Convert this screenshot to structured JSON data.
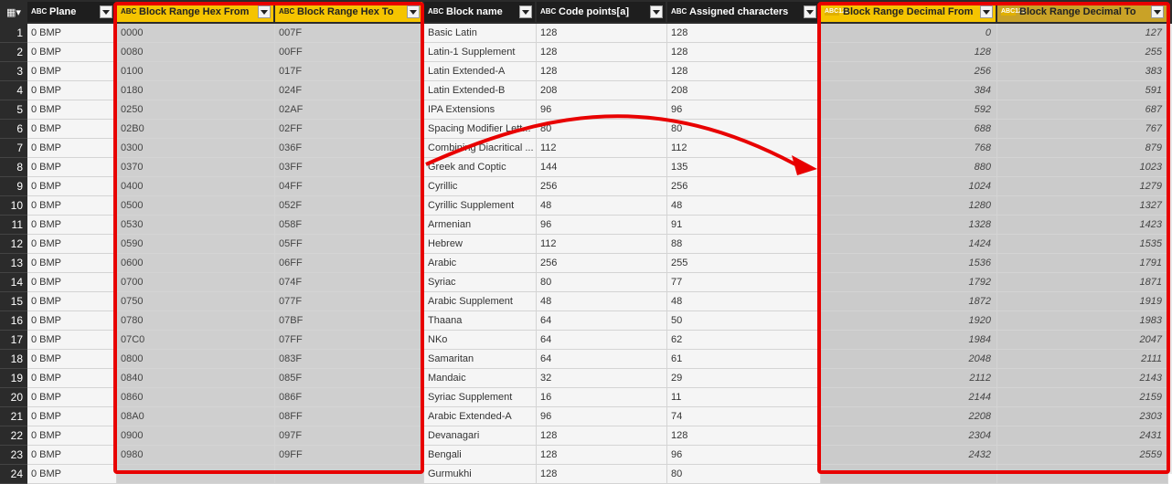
{
  "columns": [
    {
      "label": "Plane",
      "type_icon": "text-type-icon"
    },
    {
      "label": "Block Range Hex From",
      "type_icon": "text-type-icon"
    },
    {
      "label": "Block Range Hex To",
      "type_icon": "text-type-icon"
    },
    {
      "label": "Block name",
      "type_icon": "text-type-icon"
    },
    {
      "label": "Code points[a]",
      "type_icon": "text-type-icon"
    },
    {
      "label": "Assigned characters",
      "type_icon": "text-type-icon"
    },
    {
      "label": "Block Range Decimal From",
      "type_icon": "any-type-icon"
    },
    {
      "label": "Block Range Decimal To",
      "type_icon": "any-type-icon"
    }
  ],
  "type_icon_text": "ABC",
  "type_icon_any": "ABC123",
  "rows": [
    [
      "1",
      "0 BMP",
      "0000",
      "007F",
      "Basic Latin",
      "128",
      "128",
      "0",
      "127"
    ],
    [
      "2",
      "0 BMP",
      "0080",
      "00FF",
      "Latin-1 Supplement",
      "128",
      "128",
      "128",
      "255"
    ],
    [
      "3",
      "0 BMP",
      "0100",
      "017F",
      "Latin Extended-A",
      "128",
      "128",
      "256",
      "383"
    ],
    [
      "4",
      "0 BMP",
      "0180",
      "024F",
      "Latin Extended-B",
      "208",
      "208",
      "384",
      "591"
    ],
    [
      "5",
      "0 BMP",
      "0250",
      "02AF",
      "IPA Extensions",
      "96",
      "96",
      "592",
      "687"
    ],
    [
      "6",
      "0 BMP",
      "02B0",
      "02FF",
      "Spacing Modifier Lett...",
      "80",
      "80",
      "688",
      "767"
    ],
    [
      "7",
      "0 BMP",
      "0300",
      "036F",
      "Combining Diacritical ...",
      "112",
      "112",
      "768",
      "879"
    ],
    [
      "8",
      "0 BMP",
      "0370",
      "03FF",
      "Greek and Coptic",
      "144",
      "135",
      "880",
      "1023"
    ],
    [
      "9",
      "0 BMP",
      "0400",
      "04FF",
      "Cyrillic",
      "256",
      "256",
      "1024",
      "1279"
    ],
    [
      "10",
      "0 BMP",
      "0500",
      "052F",
      "Cyrillic Supplement",
      "48",
      "48",
      "1280",
      "1327"
    ],
    [
      "11",
      "0 BMP",
      "0530",
      "058F",
      "Armenian",
      "96",
      "91",
      "1328",
      "1423"
    ],
    [
      "12",
      "0 BMP",
      "0590",
      "05FF",
      "Hebrew",
      "112",
      "88",
      "1424",
      "1535"
    ],
    [
      "13",
      "0 BMP",
      "0600",
      "06FF",
      "Arabic",
      "256",
      "255",
      "1536",
      "1791"
    ],
    [
      "14",
      "0 BMP",
      "0700",
      "074F",
      "Syriac",
      "80",
      "77",
      "1792",
      "1871"
    ],
    [
      "15",
      "0 BMP",
      "0750",
      "077F",
      "Arabic Supplement",
      "48",
      "48",
      "1872",
      "1919"
    ],
    [
      "16",
      "0 BMP",
      "0780",
      "07BF",
      "Thaana",
      "64",
      "50",
      "1920",
      "1983"
    ],
    [
      "17",
      "0 BMP",
      "07C0",
      "07FF",
      "NKo",
      "64",
      "62",
      "1984",
      "2047"
    ],
    [
      "18",
      "0 BMP",
      "0800",
      "083F",
      "Samaritan",
      "64",
      "61",
      "2048",
      "2111"
    ],
    [
      "19",
      "0 BMP",
      "0840",
      "085F",
      "Mandaic",
      "32",
      "29",
      "2112",
      "2143"
    ],
    [
      "20",
      "0 BMP",
      "0860",
      "086F",
      "Syriac Supplement",
      "16",
      "11",
      "2144",
      "2159"
    ],
    [
      "21",
      "0 BMP",
      "08A0",
      "08FF",
      "Arabic Extended-A",
      "96",
      "74",
      "2208",
      "2303"
    ],
    [
      "22",
      "0 BMP",
      "0900",
      "097F",
      "Devanagari",
      "128",
      "128",
      "2304",
      "2431"
    ],
    [
      "23",
      "0 BMP",
      "0980",
      "09FF",
      "Bengali",
      "128",
      "96",
      "2432",
      "2559"
    ],
    [
      "24",
      "0 BMP",
      "",
      "",
      "Gurmukhi",
      "128",
      "80",
      "",
      ""
    ]
  ],
  "colors": {
    "highlight": "#e80000",
    "header_yellow": "#f5c400",
    "header_gold": "#c9a227"
  }
}
